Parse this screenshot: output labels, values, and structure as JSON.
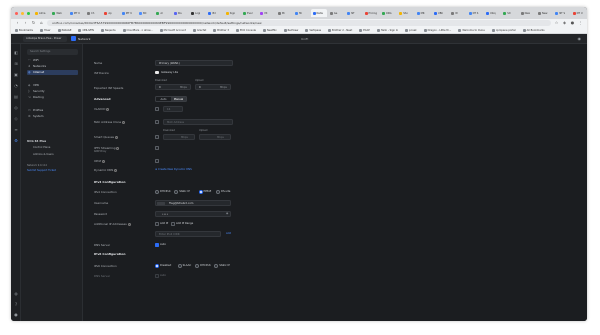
{
  "browser": {
    "tabs": [
      {
        "label": "Alma",
        "color": "#f4b400"
      },
      {
        "label": "Web",
        "color": "#34a853"
      },
      {
        "label": "MT U",
        "color": "#4285f4"
      },
      {
        "label": "Ch",
        "color": "#7a7a7a"
      },
      {
        "label": "Ap",
        "color": "#ea4335"
      },
      {
        "label": "MT U",
        "color": "#4285f4"
      },
      {
        "label": "Bd",
        "color": "#4c8dff"
      },
      {
        "label": "Al",
        "color": "#34a853"
      },
      {
        "label": "Dis",
        "color": "#5865f2"
      },
      {
        "label": "Logi",
        "color": "#333333"
      },
      {
        "label": "Bd",
        "color": "#2c6cf6"
      },
      {
        "label": "Sign",
        "color": "#f4b400"
      },
      {
        "label": "Ever",
        "color": "#34a853"
      },
      {
        "label": "Mi",
        "color": "#a142f4"
      },
      {
        "label": "Mi",
        "color": "#7a7a7a"
      },
      {
        "label": "Mi",
        "color": "#4285f4"
      },
      {
        "label": "Netw",
        "color": "#2c6cf6",
        "active": true
      },
      {
        "label": "Ge",
        "color": "#7a7a7a"
      },
      {
        "label": "NT",
        "color": "#4285f4"
      },
      {
        "label": "Pricing",
        "color": "#ea4335"
      },
      {
        "label": "ORG",
        "color": "#34a853"
      },
      {
        "label": "Sho",
        "color": "#f4b400"
      },
      {
        "label": "MR",
        "color": "#4285f4"
      },
      {
        "label": "UBC",
        "color": "#2c6cf6"
      },
      {
        "label": "W",
        "color": "#7a7a7a"
      },
      {
        "label": "NT S",
        "color": "#4285f4"
      },
      {
        "label": "Ubiq",
        "color": "#2c6cf6"
      },
      {
        "label": "Sit",
        "color": "#34a853"
      },
      {
        "label": "New",
        "color": "#7a7a7a"
      },
      {
        "label": "New",
        "color": "#7a7a7a"
      },
      {
        "label": "NT S",
        "color": "#4285f4"
      },
      {
        "label": "NT U",
        "color": "#ea4335"
      }
    ],
    "url": "unifi.ui.com/consoles/DC0A3F6A579900000000066FB7B600000000069EBF9900000000000000000/network/default/settings/networks/new",
    "bookmarks": [
      "Bookmarks",
      "Hiver",
      "PAKAGE",
      "OMLIVEN",
      "Neqenta",
      "Cloudflare · n allow...",
      "Microsoft Account",
      "Gracfet",
      "Brother 3",
      "ECO Console",
      "Neatflix",
      "RedView",
      "Vertipaas",
      "Brother 2 - Neat",
      "ECAP",
      "Hello - Sign In",
      "pcoak",
      "Dragon - Little th...",
      "Welcome to XLine",
      "cpropane portal",
      "All Bookmarks"
    ]
  },
  "app": {
    "site_selector": "Antelope Bravo-Ewe - Power",
    "product": "Network",
    "header_center": "UniFi",
    "search_placeholder": "Search Settings",
    "nav": [
      {
        "label": "WiFi",
        "icon": "wifi-icon"
      },
      {
        "label": "Networks",
        "icon": "network-icon"
      },
      {
        "label": "Internet",
        "icon": "globe-icon",
        "active": true
      },
      {
        "label": "VPN",
        "icon": "vpn-icon"
      },
      {
        "label": "Security",
        "icon": "shield-icon"
      },
      {
        "label": "Routing",
        "icon": "routing-icon"
      },
      {
        "label": "Profiles",
        "icon": "profile-icon"
      },
      {
        "label": "System",
        "icon": "gear-icon"
      }
    ],
    "group_title": "UCG 64 Plus",
    "group_items": [
      "Control Plane",
      "Admins & Users"
    ],
    "firmware_label": "Network 9.0.114",
    "firmware_link": "Submit Support Ticket"
  },
  "form": {
    "name_label": "Name",
    "name_value": "Primary (WAN1)",
    "ifd_label": "ISP Device",
    "ifd_value": "Gateway Lite",
    "ifd_dot": "#e9e9e9",
    "speeds_label": "Expected ISP Speeds",
    "download_label": "Download",
    "upload_label": "Upload",
    "download_value": "0",
    "upload_value": "0",
    "speed_unit": "Mbps",
    "advanced_label": "Advanced",
    "adv_modes": [
      "Auto",
      "Manual"
    ],
    "adv_active": 1,
    "vlan_label": "VLAN ID",
    "vlan_value": "16",
    "mac_label": "MAC Address Clone",
    "mac_placeholder": "MAC Address",
    "smart_label": "Smart Queues",
    "smart_download": "Download",
    "smart_upload": "Upload",
    "iptv_label": "IPTV Streaming",
    "iptv_sub": "IGMP Proxy",
    "upnp_label": "UPnP",
    "dns_label": "Dynamic DNS",
    "dns_link": "Create New Dynamic DNS",
    "ipv4_section": "IPv4 Configuration",
    "ipv4_conn_label": "IPv4 Connection",
    "ipv4_options": [
      "DHCPv4",
      "Static IP",
      "PPPoE",
      "DS-Lite"
    ],
    "ipv4_selected": 2,
    "username_label": "Username",
    "username_value": "fhsg@tzhebrd.com",
    "password_label": "Password",
    "password_value": "••••",
    "addl_label": "Additional IP Addresses",
    "addl_add_ip": "Add IP",
    "addl_add_range": "Add IP Range",
    "addl_placeholder": "Enter IPv4 CIDR",
    "addl_button": "Add",
    "dns_server_label": "DNS Server",
    "dns_server_opt": "Auto",
    "ipv6_section": "IPv6 Configuration",
    "ipv6_conn_label": "IPv6 Connection",
    "ipv6_options": [
      "Disabled",
      "SLAAC",
      "DHCPv6",
      "Static IP"
    ],
    "ipv6_selected": 0,
    "ipv6_dns_label": "DNS Server",
    "ipv6_dns_opt": "Auto"
  }
}
